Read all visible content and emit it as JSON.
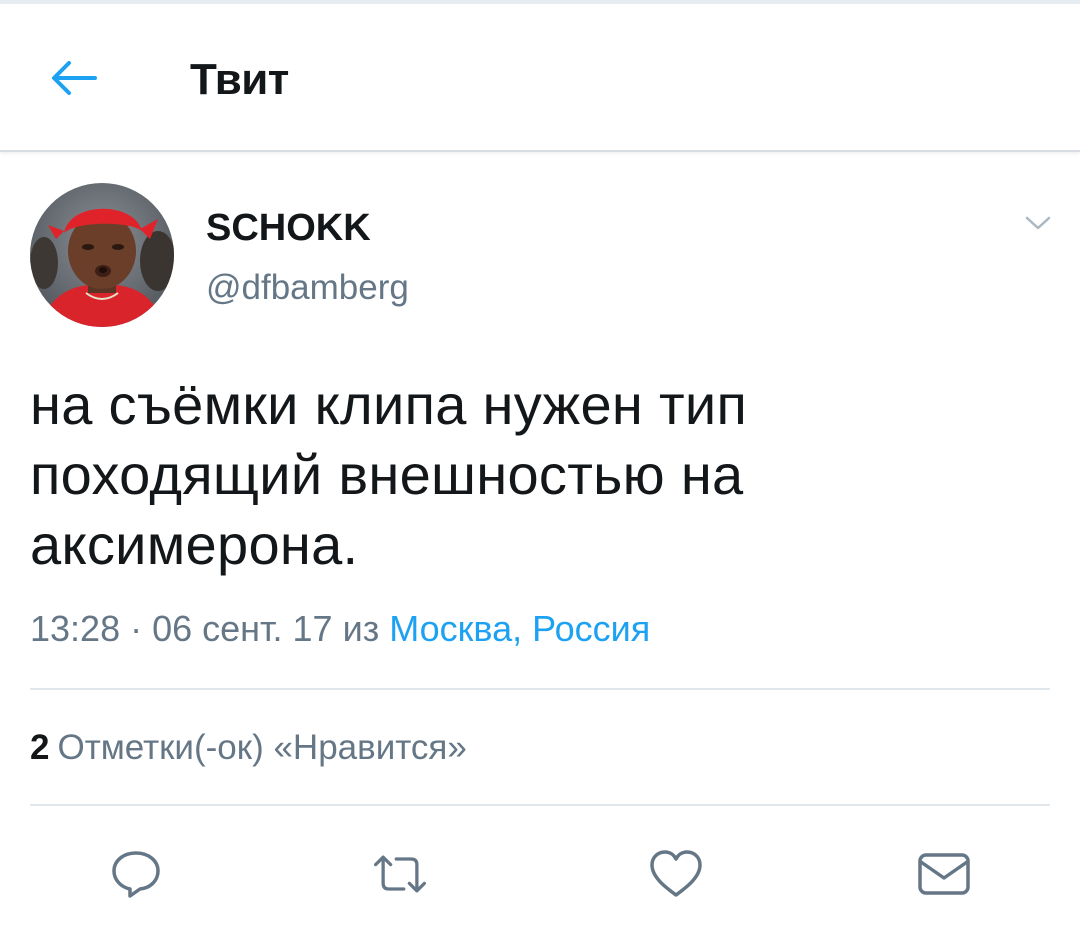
{
  "header": {
    "title": "Твит",
    "back_icon": "arrow-left-icon"
  },
  "tweet": {
    "display_name": "SCHOKK",
    "handle": "@dfbamberg",
    "text": "на съёмки клипа нужен тип походящий внешностью на аксимерона.",
    "time": "13:28 · 06 сент. 17",
    "from_label": "из",
    "location": "Москва, Россия",
    "likes_count": "2",
    "likes_label": "Отметки(-ок) «Нравится»"
  },
  "actions": [
    {
      "name": "reply",
      "icon": "reply-icon"
    },
    {
      "name": "retweet",
      "icon": "retweet-icon"
    },
    {
      "name": "like",
      "icon": "heart-icon"
    },
    {
      "name": "message",
      "icon": "envelope-icon"
    }
  ],
  "colors": {
    "accent": "#1da1f2",
    "text_primary": "#14171a",
    "text_secondary": "#657786",
    "divider": "#e1e8ed",
    "icon_gray": "#657786"
  }
}
